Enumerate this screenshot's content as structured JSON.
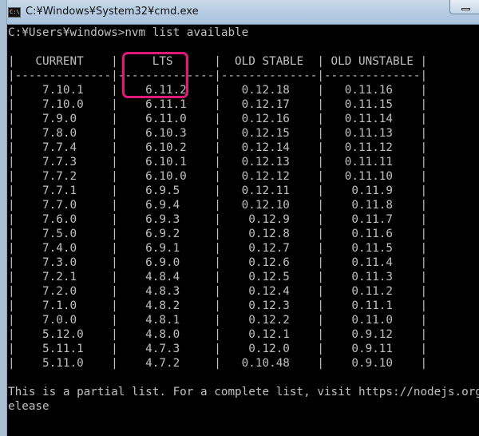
{
  "window": {
    "title": "C:¥Windows¥System32¥cmd.exe",
    "icon_label": "C:\\"
  },
  "console": {
    "prompt_line": "C:¥Users¥windows>nvm list available",
    "header": "|   CURRENT    |     LTS      |  OLD STABLE  | OLD UNSTABLE |",
    "separator": "|--------------|--------------|--------------|--------------|",
    "rows": [
      "|    7.10.1    |    6.11.2    |   0.12.18    |   0.11.16    |",
      "|    7.10.0    |    6.11.1    |   0.12.17    |   0.11.15    |",
      "|    7.9.0     |    6.11.0    |   0.12.16    |   0.11.14    |",
      "|    7.8.0     |    6.10.3    |   0.12.15    |   0.11.13    |",
      "|    7.7.4     |    6.10.2    |   0.12.14    |   0.11.12    |",
      "|    7.7.3     |    6.10.1    |   0.12.13    |   0.11.11    |",
      "|    7.7.2     |    6.10.0    |   0.12.12    |   0.11.10    |",
      "|    7.7.1     |    6.9.5     |   0.12.11    |    0.11.9    |",
      "|    7.7.0     |    6.9.4     |   0.12.10    |    0.11.8    |",
      "|    7.6.0     |    6.9.3     |    0.12.9    |    0.11.7    |",
      "|    7.5.0     |    6.9.2     |    0.12.8    |    0.11.6    |",
      "|    7.4.0     |    6.9.1     |    0.12.7    |    0.11.5    |",
      "|    7.3.0     |    6.9.0     |    0.12.6    |    0.11.4    |",
      "|    7.2.1     |    4.8.4     |    0.12.5    |    0.11.3    |",
      "|    7.2.0     |    4.8.3     |    0.12.4    |    0.11.2    |",
      "|    7.1.0     |    4.8.2     |    0.12.3    |    0.11.1    |",
      "|    7.0.0     |    4.8.1     |    0.12.2    |    0.11.0    |",
      "|    5.12.0    |    4.8.0     |    0.12.1    |    0.9.12    |",
      "|    5.11.1    |    4.7.3     |    0.12.0    |    0.9.11    |",
      "|    5.11.0    |    4.7.2     |   0.10.48    |    0.9.10    |"
    ],
    "footer_line_1": "This is a partial list. For a complete list, visit https://nodejs.org/down",
    "footer_line_2": "elease"
  },
  "colors": {
    "console_bg": "#000000",
    "console_text": "#c0c0c0",
    "highlight": "#e0187a"
  }
}
